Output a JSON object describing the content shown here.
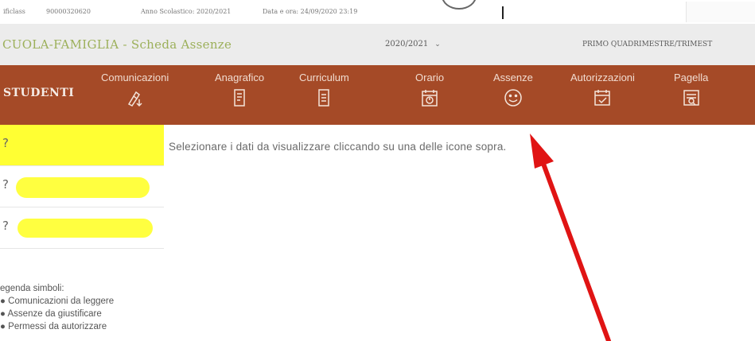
{
  "topbar": {
    "field1_label": "ificlass",
    "field1_value": "90000320620",
    "school_year_label": "Anno Scolastico: 2020/2021",
    "datetime_label": "Data e ora: 24/09/2020 23:19"
  },
  "header": {
    "app_title": "CUOLA-FAMIGLIA - Scheda Assenze",
    "school_year": "2020/2021",
    "period": "PRIMO QUADRIMESTRE/TRIMEST"
  },
  "nav": {
    "brand": "STUDENTI",
    "items": [
      {
        "label": "Comunicazioni",
        "icon": "communications-icon"
      },
      {
        "label": "Anagrafico",
        "icon": "registry-icon"
      },
      {
        "label": "Curriculum",
        "icon": "curriculum-icon"
      },
      {
        "label": "Orario",
        "icon": "timetable-icon"
      },
      {
        "label": "Assenze",
        "icon": "smiley-icon"
      },
      {
        "label": "Autorizzazioni",
        "icon": "calendar-check-icon"
      },
      {
        "label": "Pagella",
        "icon": "report-card-icon"
      }
    ]
  },
  "sidebar": {
    "students": [
      {
        "marker": "?"
      },
      {
        "marker": "?"
      },
      {
        "marker": "?"
      }
    ],
    "legend": {
      "title": "egenda simboli:",
      "items": [
        "Comunicazioni da leggere",
        "Assenze da giustificare",
        "Permessi da autorizzare"
      ]
    }
  },
  "main": {
    "message": "Selezionare i dati da visualizzare cliccando su una delle icone sopra."
  },
  "colors": {
    "nav_background": "#a54a27",
    "title_green": "#9cb05a",
    "highlight_yellow": "#ffff33",
    "annotation_arrow": "#e01414"
  }
}
